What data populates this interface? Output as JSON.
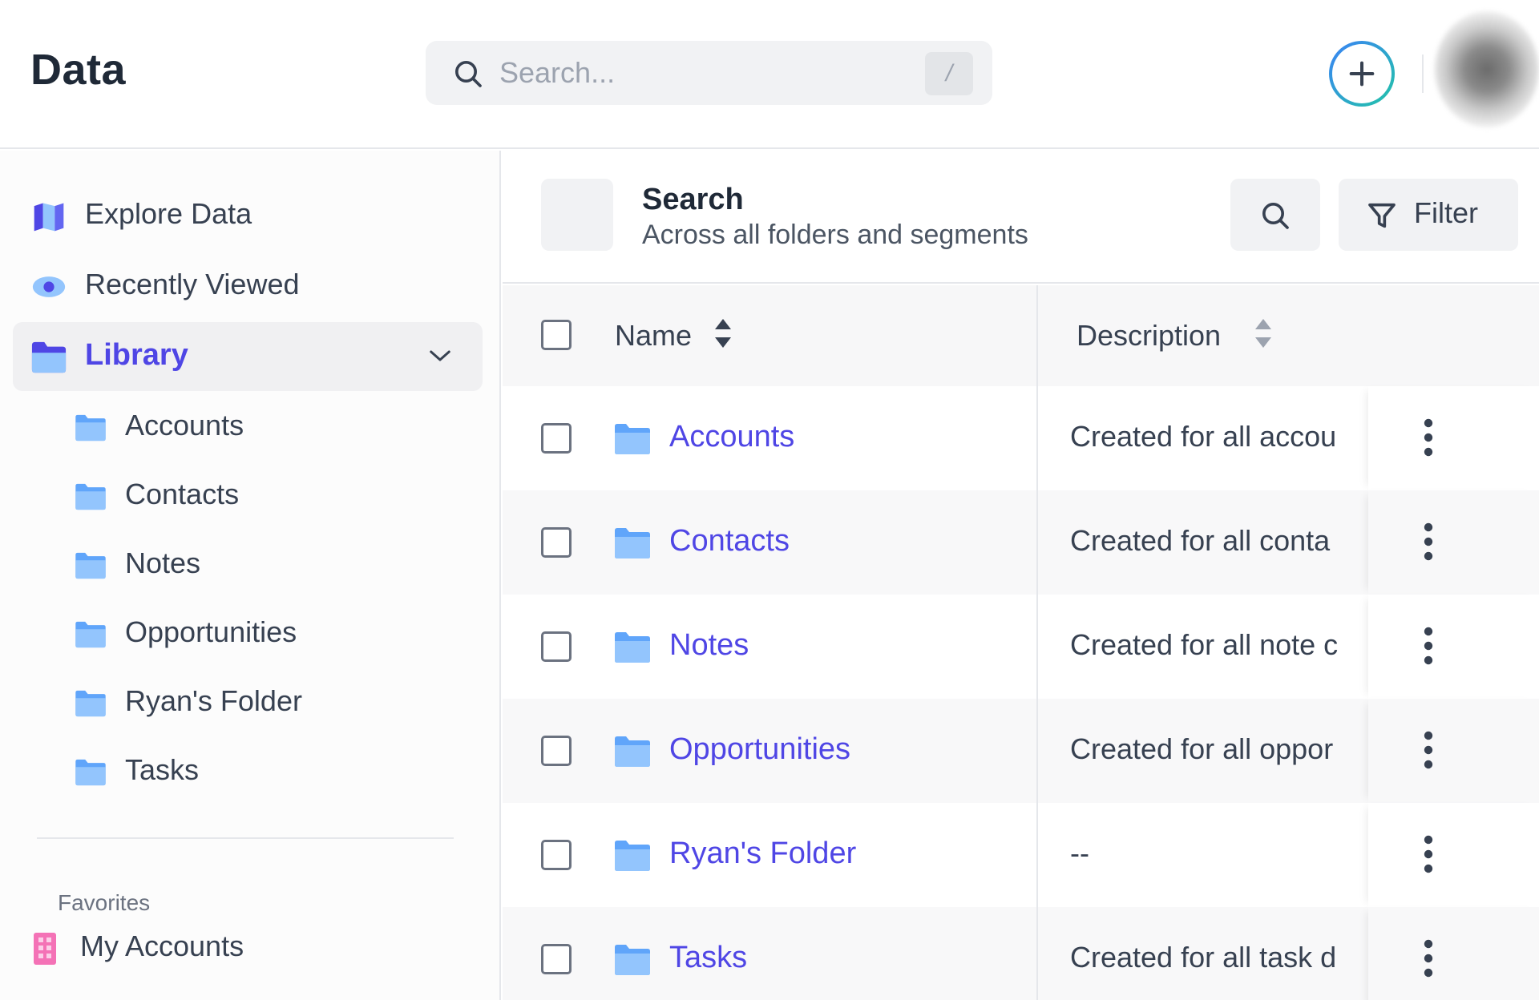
{
  "header": {
    "title": "Data",
    "search": {
      "placeholder": "Search...",
      "shortcut": "/"
    },
    "add_icon": "plus-circle-icon",
    "avatar": "user-avatar"
  },
  "sidebar": {
    "items": [
      {
        "label": "Explore Data",
        "icon": "map-icon"
      },
      {
        "label": "Recently Viewed",
        "icon": "eye-icon"
      },
      {
        "label": "Library",
        "icon": "folder-icon",
        "expanded": true
      }
    ],
    "library_children": [
      {
        "label": "Accounts"
      },
      {
        "label": "Contacts"
      },
      {
        "label": "Notes"
      },
      {
        "label": "Opportunities"
      },
      {
        "label": "Ryan's Folder"
      },
      {
        "label": "Tasks"
      }
    ],
    "favorites_heading": "Favorites",
    "favorites": [
      {
        "label": "My Accounts",
        "icon": "building-icon"
      }
    ]
  },
  "main": {
    "search_header": {
      "title": "Search",
      "subtitle": "Across all folders and segments",
      "filter_label": "Filter"
    },
    "table": {
      "columns": [
        "Name",
        "Description"
      ],
      "rows": [
        {
          "name": "Accounts",
          "description": "Created for all accou"
        },
        {
          "name": "Contacts",
          "description": "Created for all conta"
        },
        {
          "name": "Notes",
          "description": "Created for all note c"
        },
        {
          "name": "Opportunities",
          "description": "Created for all oppor"
        },
        {
          "name": "Ryan's Folder",
          "description": "--"
        },
        {
          "name": "Tasks",
          "description": "Created for all task d"
        }
      ]
    }
  },
  "colors": {
    "accent": "#4f46e5",
    "folder": "#93c5fd",
    "folder_dark": "#60a5fa",
    "active_bg": "#f0f0f2"
  }
}
